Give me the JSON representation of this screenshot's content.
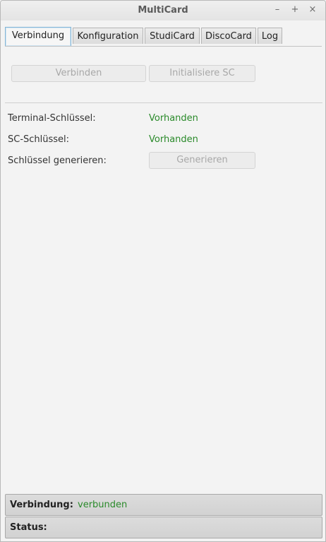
{
  "window": {
    "title": "MultiCard",
    "controls": {
      "minimize": "–",
      "maximize": "+",
      "close": "×"
    }
  },
  "tabs": [
    {
      "label": "Verbindung",
      "active": true
    },
    {
      "label": "Konfiguration",
      "active": false
    },
    {
      "label": "StudiCard",
      "active": false
    },
    {
      "label": "DiscoCard",
      "active": false
    },
    {
      "label": "Log",
      "active": false
    }
  ],
  "actions": {
    "connect_label": "Verbinden",
    "init_sc_label": "Initialisiere SC"
  },
  "keys": {
    "terminal_key_label": "Terminal-Schlüssel:",
    "terminal_key_value": "Vorhanden",
    "sc_key_label": "SC-Schlüssel:",
    "sc_key_value": "Vorhanden",
    "generate_label": "Schlüssel generieren:",
    "generate_button": "Generieren"
  },
  "status": {
    "connection_label": "Verbindung:",
    "connection_value": "verbunden",
    "status_label": "Status:",
    "status_value": ""
  },
  "colors": {
    "ok": "#2a8a2a",
    "active_tab_border": "#86b6d6",
    "disabled_text": "#a8a8a8"
  }
}
